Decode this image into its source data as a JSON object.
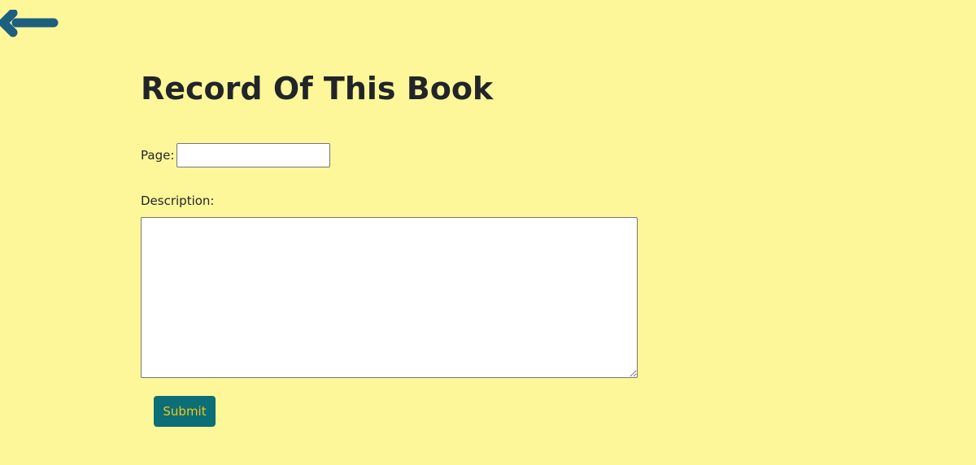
{
  "nav": {
    "back_icon": "arrow-left-icon",
    "back_icon_color": "#1c5f7f"
  },
  "page": {
    "title": "Record Of This Book",
    "background_color": "#fef799"
  },
  "form": {
    "page_label": "Page:",
    "page_value": "",
    "description_label": "Description:",
    "description_value": "",
    "submit_label": "Submit",
    "submit_bg_color": "#0c6e76",
    "submit_text_color": "#f5c518"
  }
}
